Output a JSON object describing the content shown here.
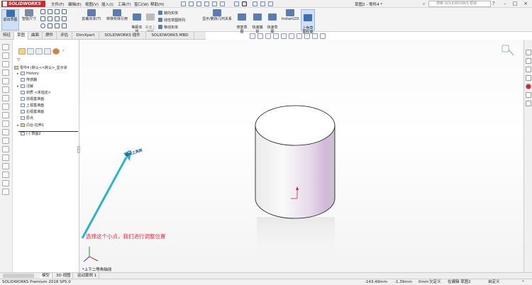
{
  "app": {
    "logo_text": "SOLIDWORKS",
    "doc_title": "草图2 - 零件4 *",
    "menu": [
      "文件(F)",
      "编辑(E)",
      "视图(V)",
      "插入(I)",
      "工具(T)",
      "窗口(W)",
      "帮助(H)"
    ],
    "help_search_placeholder": "搜索 SOLIDWORKS 帮助",
    "colors": {
      "brand": "#d8232a",
      "accent": "#4a6fa5",
      "annotation": "#e0283c",
      "arrow": "#2bb5c8"
    }
  },
  "commands": {
    "exit_sketch": "退出草图",
    "smart_dimension": "智能尺寸",
    "trim": "剪裁实体(T)",
    "convert": "转换实体引用",
    "offset": "等距实\n体",
    "surface_offset": "曲面上\n偏移",
    "mirror": "镜向实体",
    "linear_pattern": "线性草图阵列",
    "move": "移动实体",
    "display_delete": "显示/删除几何关系",
    "repair": "修复草\n图",
    "quick_snap": "快速捕\n捉",
    "rapid_sketch": "快速草\n图",
    "instant2d": "Instant2D",
    "shaded_sketch": "上色草\n图轮廓"
  },
  "tabs": [
    "特征",
    "草图",
    "曲面",
    "焊件",
    "评估",
    "DimXpert",
    "SOLIDWORKS 插件",
    "SOLIDWORKS MBD"
  ],
  "active_tab": "草图",
  "tree": {
    "root": "零件4 (默认<<默认>_显示状",
    "items": [
      {
        "label": "History",
        "expand": "▸"
      },
      {
        "label": "传感器",
        "expand": ""
      },
      {
        "label": "注解",
        "expand": "▸"
      },
      {
        "label": "材质 <未指定>",
        "expand": ""
      },
      {
        "label": "前视基准面",
        "expand": ""
      },
      {
        "label": "上视基准面",
        "expand": ""
      },
      {
        "label": "右视基准面",
        "expand": ""
      },
      {
        "label": "原点",
        "expand": ""
      },
      {
        "label": "凸台-拉伸1",
        "expand": "▸"
      },
      {
        "label": "(-) 草图2",
        "expand": ""
      }
    ]
  },
  "viewport": {
    "annotation": "选择这个小点，我们进行调整位置",
    "point_label": "驱动工具网",
    "view_label": "*上下二等角轴测"
  },
  "model_tabs": [
    "模型",
    "3D 视图",
    "运动算例 1"
  ],
  "status": {
    "product": "SOLIDWORKS Premium 2018 SP5.0",
    "x": "-143.49mm",
    "y": "-1.39mm",
    "z": "0mm",
    "constraint": "欠定义",
    "editing": "在编辑 草图2",
    "units": "自定义"
  }
}
